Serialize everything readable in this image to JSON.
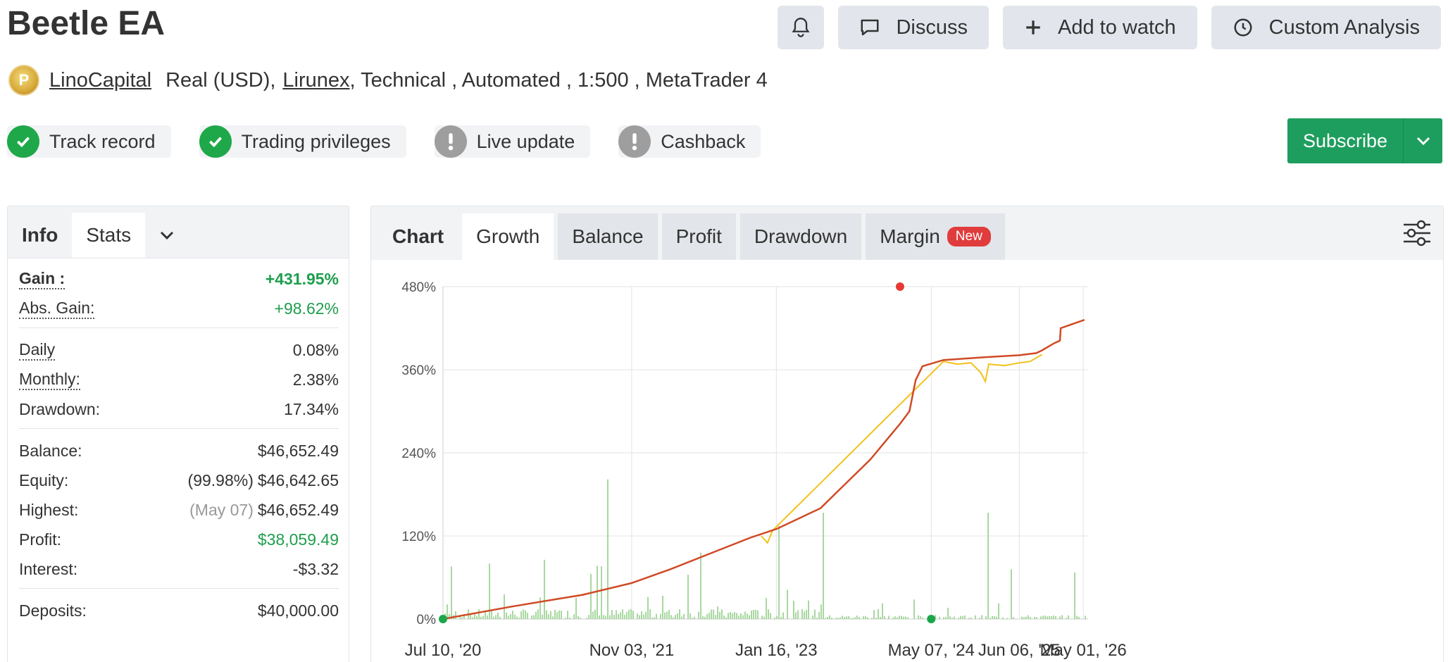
{
  "header": {
    "title": "Beetle EA",
    "actions": {
      "discuss": "Discuss",
      "watch": "Add to watch",
      "analysis": "Custom Analysis"
    }
  },
  "meta": {
    "owner": "LinoCapital",
    "account_type": "Real (USD),",
    "broker": "Lirunex",
    "details": ", Technical , Automated , 1:500 , MetaTrader 4"
  },
  "badges": {
    "track_record": "Track record",
    "trading_privileges": "Trading privileges",
    "live_update": "Live update",
    "cashback": "Cashback"
  },
  "subscribe": {
    "label": "Subscribe"
  },
  "left_tabs": {
    "info": "Info",
    "stats": "Stats"
  },
  "stats": {
    "gain": {
      "label": "Gain :",
      "value": "+431.95%"
    },
    "abs_gain": {
      "label": "Abs. Gain:",
      "value": "+98.62%"
    },
    "daily": {
      "label": "Daily",
      "value": "0.08%"
    },
    "monthly": {
      "label": "Monthly:",
      "value": "2.38%"
    },
    "drawdown": {
      "label": "Drawdown:",
      "value": "17.34%"
    },
    "balance": {
      "label": "Balance:",
      "value": "$46,652.49"
    },
    "equity": {
      "label": "Equity:",
      "note": "(99.98%)",
      "value": "$46,642.65"
    },
    "highest": {
      "label": "Highest:",
      "note": "(May 07)",
      "value": "$46,652.49"
    },
    "profit": {
      "label": "Profit:",
      "value": "$38,059.49"
    },
    "interest": {
      "label": "Interest:",
      "value": "-$3.32"
    },
    "deposits": {
      "label": "Deposits:",
      "value": "$40,000.00"
    }
  },
  "chart_tabs": {
    "chart": "Chart",
    "growth": "Growth",
    "balance": "Balance",
    "profit": "Profit",
    "drawdown": "Drawdown",
    "margin": "Margin",
    "new_badge": "New"
  },
  "colors": {
    "accent_green": "#1e9e5e",
    "gain_line": "#d04a26",
    "equity_line": "#f2c21b",
    "bars": "#a8d8a0"
  },
  "chart_data": {
    "type": "line",
    "title": "",
    "xlabel": "",
    "ylabel": "",
    "x_ticks": [
      "Jul 10, '20",
      "Nov 03, '21",
      "Jan 16, '23",
      "May 07, '24",
      "Jun 06, '25",
      "May 01, '26"
    ],
    "y_ticks": [
      "0%",
      "120%",
      "240%",
      "360%",
      "480%"
    ],
    "ylim": [
      0,
      480
    ],
    "grid": true,
    "series": [
      {
        "values_by_date": [
          [
            "2020-07-10",
            0
          ],
          [
            "2021-01-01",
            18
          ],
          [
            "2021-07-01",
            35
          ],
          [
            "2021-11-03",
            52
          ],
          [
            "2022-03-01",
            72
          ],
          [
            "2022-07-01",
            95
          ],
          [
            "2022-11-01",
            118
          ],
          [
            "2023-01-16",
            130
          ],
          [
            "2023-06-01",
            160
          ],
          [
            "2023-08-01",
            188
          ],
          [
            "2023-11-01",
            230
          ],
          [
            "2024-02-01",
            282
          ],
          [
            "2024-03-01",
            300
          ],
          [
            "2024-03-20",
            345
          ],
          [
            "2024-04-10",
            365
          ],
          [
            "2024-07-01",
            374
          ],
          [
            "2024-10-01",
            376
          ],
          [
            "2025-01-01",
            378
          ],
          [
            "2025-06-06",
            381
          ],
          [
            "2025-09-01",
            384
          ],
          [
            "2025-10-01",
            388
          ],
          [
            "2025-12-01",
            398
          ],
          [
            "2026-01-01",
            402
          ],
          [
            "2026-01-05",
            420
          ],
          [
            "2026-05-07",
            432
          ]
        ]
      },
      {
        "values_by_date": [
          [
            "2022-12-01",
            120
          ],
          [
            "2022-12-20",
            110
          ],
          [
            "2023-01-05",
            128
          ],
          [
            "2024-07-01",
            372
          ],
          [
            "2024-09-01",
            368
          ],
          [
            "2024-11-01",
            370
          ],
          [
            "2024-12-15",
            356
          ],
          [
            "2025-01-05",
            343
          ],
          [
            "2025-01-20",
            368
          ],
          [
            "2025-04-01",
            366
          ],
          [
            "2025-06-06",
            370
          ],
          [
            "2025-08-01",
            372
          ],
          [
            "2025-10-01",
            382
          ]
        ]
      }
    ]
  }
}
